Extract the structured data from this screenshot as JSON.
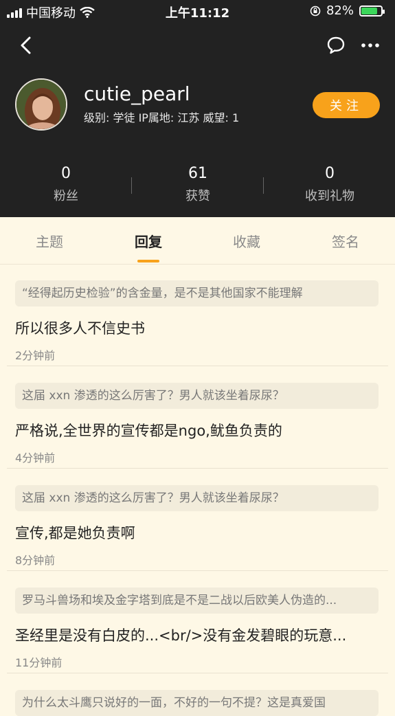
{
  "status_bar": {
    "carrier": "中国移动",
    "time": "上午11:12",
    "battery_pct": "82%",
    "battery_level": 0.82
  },
  "nav": {
    "back_icon": "chevron-left-icon",
    "message_icon": "chat-bubble-icon",
    "more_icon": "more-icon"
  },
  "profile": {
    "username": "cutie_pearl",
    "meta": "级别: 学徒  IP属地: 江苏  威望: 1",
    "follow_label": "关注"
  },
  "stats": [
    {
      "num": "0",
      "label": "粉丝"
    },
    {
      "num": "61",
      "label": "获赞"
    },
    {
      "num": "0",
      "label": "收到礼物"
    }
  ],
  "tabs": [
    {
      "label": "主题",
      "active": false
    },
    {
      "label": "回复",
      "active": true
    },
    {
      "label": "收藏",
      "active": false
    },
    {
      "label": "签名",
      "active": false
    }
  ],
  "replies": [
    {
      "quote": "“经得起历史检验”的含金量，是不是其他国家不能理解",
      "text": "所以很多人不信史书",
      "time": "2分钟前"
    },
    {
      "quote": "这届 xxn 渗透的这么厉害了？男人就该坐着尿尿？",
      "text": "严格说,全世界的宣传都是ngo,鱿鱼负责的",
      "time": "4分钟前"
    },
    {
      "quote": "这届 xxn 渗透的这么厉害了？男人就该坐着尿尿？",
      "text": "宣传,都是她负责啊",
      "time": "8分钟前"
    },
    {
      "quote": "罗马斗兽场和埃及金字塔到底是不是二战以后欧美人伪造的...",
      "text": "圣经里是没有白皮的...<br/>没有金发碧眼的玩意...",
      "time": "11分钟前"
    },
    {
      "quote": "为什么太斗鹰只说好的一面，不好的一句不提？这是真爱国",
      "text": "",
      "time": ""
    }
  ]
}
